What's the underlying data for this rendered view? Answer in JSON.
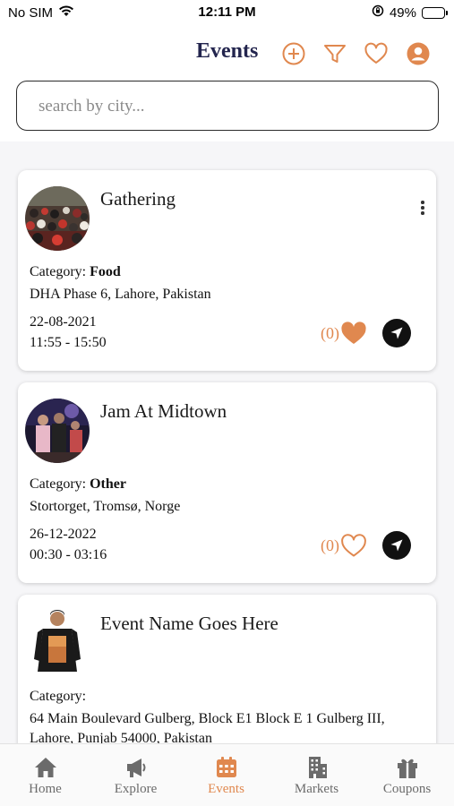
{
  "status_bar": {
    "carrier": "No SIM",
    "time": "12:11 PM",
    "battery": "49%",
    "battery_level": 0.49
  },
  "header": {
    "title": "Events",
    "icons": [
      "add-icon",
      "filter-icon",
      "heart-icon",
      "profile-icon"
    ],
    "accent_color": "#e0884f",
    "title_color": "#23254e"
  },
  "search": {
    "placeholder": "search by city...",
    "value": ""
  },
  "events": [
    {
      "name": "Gathering",
      "category_label": "Category:",
      "category": "Food",
      "address": "DHA Phase 6, Lahore, Pakistan",
      "date": "22-08-2021",
      "time": "11:55 - 15:50",
      "likes": "(0)",
      "liked": true
    },
    {
      "name": "Jam At Midtown",
      "category_label": "Category:",
      "category": "Other",
      "address": "Stortorget, Tromsø, Norge",
      "date": "26-12-2022",
      "time": "00:30 - 03:16",
      "likes": "(0)",
      "liked": false
    },
    {
      "name": "Event Name Goes Here",
      "category_label": "Category:",
      "category": "",
      "address_line1": "64 Main Boulevard Gulberg, Block E1 Block E 1 Gulberg III,",
      "address_line2": "Lahore, Punjab 54000, Pakistan"
    }
  ],
  "tabs": [
    {
      "label": "Home",
      "icon": "home-icon",
      "active": false
    },
    {
      "label": "Explore",
      "icon": "megaphone-icon",
      "active": false
    },
    {
      "label": "Events",
      "icon": "calendar-icon",
      "active": true
    },
    {
      "label": "Markets",
      "icon": "building-icon",
      "active": false
    },
    {
      "label": "Coupons",
      "icon": "gift-icon",
      "active": false
    }
  ]
}
